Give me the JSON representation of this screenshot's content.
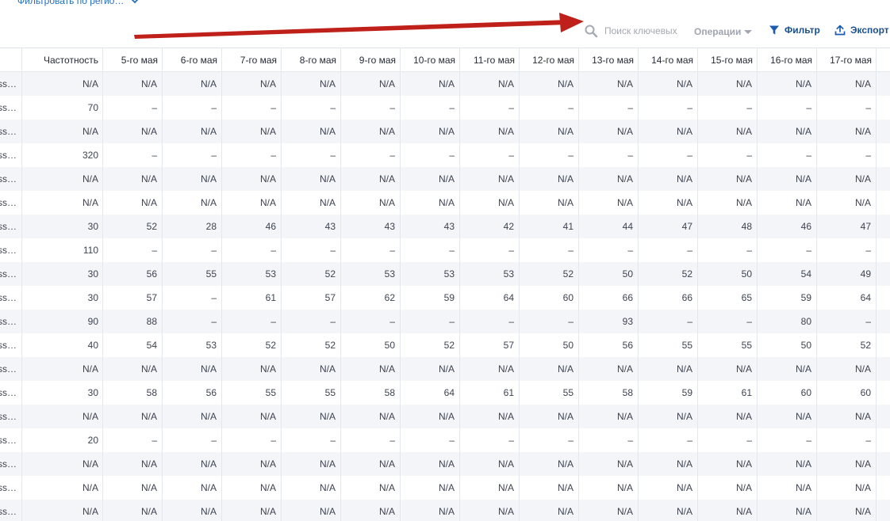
{
  "region_filter": {
    "label": "Фильтровать по регио…"
  },
  "toolbar": {
    "search_placeholder": "Поиск ключевых",
    "operations_label": "Операции",
    "filter_label": "Фильтр",
    "export_label": "Экспорт"
  },
  "table": {
    "columns": [
      "Частотность",
      "5-го мая",
      "6-го мая",
      "7-го мая",
      "8-го мая",
      "9-го мая",
      "10-го мая",
      "11-го мая",
      "12-го мая",
      "13-го мая",
      "14-го мая",
      "15-го мая",
      "16-го мая",
      "17-го мая"
    ],
    "rows": [
      {
        "keyword": "ss…",
        "cells": [
          "N/A",
          "N/A",
          "N/A",
          "N/A",
          "N/A",
          "N/A",
          "N/A",
          "N/A",
          "N/A",
          "N/A",
          "N/A",
          "N/A",
          "N/A",
          "N/A"
        ]
      },
      {
        "keyword": "ss…",
        "cells": [
          "70",
          "–",
          "–",
          "–",
          "–",
          "–",
          "–",
          "–",
          "–",
          "–",
          "–",
          "–",
          "–",
          "–"
        ]
      },
      {
        "keyword": "ss…",
        "cells": [
          "N/A",
          "N/A",
          "N/A",
          "N/A",
          "N/A",
          "N/A",
          "N/A",
          "N/A",
          "N/A",
          "N/A",
          "N/A",
          "N/A",
          "N/A",
          "N/A"
        ]
      },
      {
        "keyword": "ss…",
        "cells": [
          "320",
          "–",
          "–",
          "–",
          "–",
          "–",
          "–",
          "–",
          "–",
          "–",
          "–",
          "–",
          "–",
          "–"
        ]
      },
      {
        "keyword": "ss…",
        "cells": [
          "N/A",
          "N/A",
          "N/A",
          "N/A",
          "N/A",
          "N/A",
          "N/A",
          "N/A",
          "N/A",
          "N/A",
          "N/A",
          "N/A",
          "N/A",
          "N/A"
        ]
      },
      {
        "keyword": "ss…",
        "cells": [
          "N/A",
          "N/A",
          "N/A",
          "N/A",
          "N/A",
          "N/A",
          "N/A",
          "N/A",
          "N/A",
          "N/A",
          "N/A",
          "N/A",
          "N/A",
          "N/A"
        ]
      },
      {
        "keyword": "ss…",
        "cells": [
          "30",
          "52",
          "28",
          "46",
          "43",
          "43",
          "43",
          "42",
          "41",
          "44",
          "47",
          "48",
          "46",
          "47"
        ]
      },
      {
        "keyword": "ss…",
        "cells": [
          "110",
          "–",
          "–",
          "–",
          "–",
          "–",
          "–",
          "–",
          "–",
          "–",
          "–",
          "–",
          "–",
          "–"
        ]
      },
      {
        "keyword": "ss…",
        "cells": [
          "30",
          "56",
          "55",
          "53",
          "52",
          "53",
          "53",
          "53",
          "52",
          "50",
          "52",
          "50",
          "54",
          "49"
        ]
      },
      {
        "keyword": "ss…",
        "cells": [
          "30",
          "57",
          "–",
          "61",
          "57",
          "62",
          "59",
          "64",
          "60",
          "66",
          "66",
          "65",
          "59",
          "64"
        ]
      },
      {
        "keyword": "ss…",
        "cells": [
          "90",
          "88",
          "–",
          "–",
          "–",
          "–",
          "–",
          "–",
          "–",
          "93",
          "–",
          "–",
          "80",
          "–"
        ]
      },
      {
        "keyword": "ss…",
        "cells": [
          "40",
          "54",
          "53",
          "52",
          "52",
          "50",
          "52",
          "57",
          "50",
          "56",
          "55",
          "55",
          "50",
          "52"
        ]
      },
      {
        "keyword": "ss…",
        "cells": [
          "N/A",
          "N/A",
          "N/A",
          "N/A",
          "N/A",
          "N/A",
          "N/A",
          "N/A",
          "N/A",
          "N/A",
          "N/A",
          "N/A",
          "N/A",
          "N/A"
        ]
      },
      {
        "keyword": "ss…",
        "cells": [
          "30",
          "58",
          "56",
          "55",
          "55",
          "58",
          "64",
          "61",
          "55",
          "58",
          "59",
          "61",
          "60",
          "60"
        ]
      },
      {
        "keyword": "ss…",
        "cells": [
          "N/A",
          "N/A",
          "N/A",
          "N/A",
          "N/A",
          "N/A",
          "N/A",
          "N/A",
          "N/A",
          "N/A",
          "N/A",
          "N/A",
          "N/A",
          "N/A"
        ]
      },
      {
        "keyword": "ss…",
        "cells": [
          "20",
          "–",
          "–",
          "–",
          "–",
          "–",
          "–",
          "–",
          "–",
          "–",
          "–",
          "–",
          "–",
          "–"
        ]
      },
      {
        "keyword": "ss…",
        "cells": [
          "N/A",
          "N/A",
          "N/A",
          "N/A",
          "N/A",
          "N/A",
          "N/A",
          "N/A",
          "N/A",
          "N/A",
          "N/A",
          "N/A",
          "N/A",
          "N/A"
        ]
      },
      {
        "keyword": "ss…",
        "cells": [
          "N/A",
          "N/A",
          "N/A",
          "N/A",
          "N/A",
          "N/A",
          "N/A",
          "N/A",
          "N/A",
          "N/A",
          "N/A",
          "N/A",
          "N/A",
          "N/A"
        ]
      },
      {
        "keyword": "ss…",
        "cells": [
          "N/A",
          "N/A",
          "N/A",
          "N/A",
          "N/A",
          "N/A",
          "N/A",
          "N/A",
          "N/A",
          "N/A",
          "N/A",
          "N/A",
          "N/A",
          "N/A"
        ]
      }
    ]
  },
  "icons": {
    "search": "search-icon",
    "filter": "funnel-icon",
    "export": "upload-icon",
    "dropdown": "chevron-down-icon"
  },
  "colors": {
    "accent": "#1a4f8e",
    "link": "#2a6ebb",
    "annotation_arrow": "#c0201a",
    "row_stripe": "#f3f5f9"
  }
}
